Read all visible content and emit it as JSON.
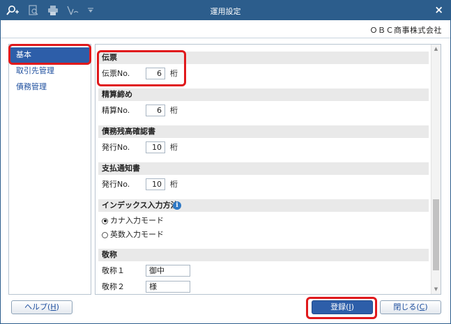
{
  "titlebar": {
    "title": "運用設定",
    "close_glyph": "×",
    "tool_icons": [
      "search-plus-icon",
      "preview-icon",
      "print-icon",
      "export-icon",
      "dropdown-icon"
    ]
  },
  "company": "ＯＢＣ商事株式会社",
  "nav": {
    "items": [
      {
        "label": "基本",
        "active": true
      },
      {
        "label": "取引先管理",
        "active": false
      },
      {
        "label": "債務管理",
        "active": false
      }
    ]
  },
  "sections": {
    "denpyo": {
      "title": "伝票",
      "label": "伝票No.",
      "value": "6",
      "unit": "桁"
    },
    "seisan": {
      "title": "精算締め",
      "label": "精算No.",
      "value": "6",
      "unit": "桁"
    },
    "saimu": {
      "title": "債務残高確認書",
      "label": "発行No.",
      "value": "10",
      "unit": "桁"
    },
    "shiharai": {
      "title": "支払通知書",
      "label": "発行No.",
      "value": "10",
      "unit": "桁"
    },
    "index": {
      "title": "インデックス入力方法",
      "options": [
        {
          "label": "カナ入力モード",
          "checked": true
        },
        {
          "label": "英数入力モード",
          "checked": false
        }
      ]
    },
    "keisho": {
      "title": "敬称",
      "rows": [
        {
          "label": "敬称１",
          "value": "御中"
        },
        {
          "label": "敬称２",
          "value": "様"
        }
      ]
    }
  },
  "footer": {
    "help": {
      "text": "ヘルプ(",
      "key": "H",
      "close": ")"
    },
    "register": {
      "text": "登録(",
      "key": "I",
      "close": ")"
    },
    "close": {
      "text": "閉じる(",
      "key": "C",
      "close": ")"
    }
  },
  "colors": {
    "titlebar": "#2c5d8c",
    "accent": "#2d5ea9",
    "highlight": "#e0191c"
  }
}
